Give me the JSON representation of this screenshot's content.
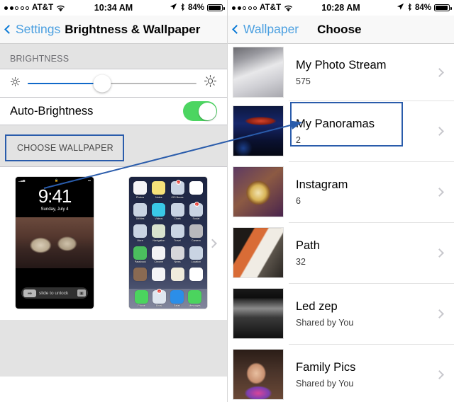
{
  "left_panel": {
    "status_bar": {
      "signal_dots_filled": 2,
      "signal_dots_total": 5,
      "carrier": "AT&T",
      "wifi_icon": "wifi-icon",
      "time": "10:34 AM",
      "location_icon": "location-arrow-icon",
      "bluetooth_icon": "bluetooth-icon",
      "battery_percent": "84%",
      "battery_icon": "battery-icon"
    },
    "nav": {
      "back_icon": "chevron-left-icon",
      "back_label": "Settings",
      "title": "Brightness & Wallpaper"
    },
    "brightness": {
      "section_header": "BRIGHTNESS",
      "slider": {
        "low_icon": "sun-small-icon",
        "high_icon": "sun-large-icon",
        "value_percent": 44,
        "fill_color": "#1169c9",
        "track_color": "#b9b9b9"
      },
      "auto_brightness": {
        "label": "Auto-Brightness",
        "toggle_state": "on",
        "toggle_color": "#4cd561"
      }
    },
    "choose_wallpaper": {
      "header": "CHOOSE WALLPAPER",
      "chevron_icon": "chevron-right-icon",
      "lock_preview": {
        "time": "9:41",
        "date": "Sunday, July 4",
        "slide_text": "slide to unlock",
        "slide_arrow_icon": "arrow-right-icon",
        "camera_icon": "camera-icon",
        "lock_icon": "lock-icon"
      },
      "home_preview": {
        "apps": [
          {
            "label": "Photos",
            "color": "#f4f4f6",
            "badge": ""
          },
          {
            "label": "Notes",
            "color": "#f6e27a",
            "badge": ""
          },
          {
            "label": "iOS Boxes",
            "color": "#c9d4e3",
            "badge": "32"
          },
          {
            "label": "",
            "color": "#ffffff",
            "badge": ""
          },
          {
            "label": "Utilities",
            "color": "#c9d4e3",
            "badge": ""
          },
          {
            "label": "Videos",
            "color": "#39c8e6",
            "badge": ""
          },
          {
            "label": "Chats",
            "color": "#c9d4e3",
            "badge": ""
          },
          {
            "label": "Social",
            "color": "#c9d4e3",
            "badge": "1"
          },
          {
            "label": "More",
            "color": "#c9d4e3",
            "badge": ""
          },
          {
            "label": "Navigation",
            "color": "#d8e2ce",
            "badge": ""
          },
          {
            "label": "Travel",
            "color": "#c9d4e3",
            "badge": ""
          },
          {
            "label": "Camera",
            "color": "#b9b9bd",
            "badge": ""
          },
          {
            "label": "Passbook",
            "color": "#4bbf5e",
            "badge": ""
          },
          {
            "label": "Chrome",
            "color": "#f2f2f4",
            "badge": ""
          },
          {
            "label": "News",
            "color": "#d6d6da",
            "badge": ""
          },
          {
            "label": "Location",
            "color": "#c9d4e3",
            "badge": ""
          },
          {
            "label": "",
            "color": "#8a6a52",
            "badge": ""
          },
          {
            "label": "",
            "color": "#f4f4f6",
            "badge": ""
          },
          {
            "label": "",
            "color": "#f0ebdc",
            "badge": ""
          },
          {
            "label": "",
            "color": "#ffffff",
            "badge": ""
          }
        ],
        "dock": [
          {
            "label": "Phone",
            "color": "#4bd45e",
            "badge": ""
          },
          {
            "label": "Email",
            "color": "#dfe6ef",
            "badge": "8"
          },
          {
            "label": "Safari",
            "color": "#2b8ee8",
            "badge": ""
          },
          {
            "label": "Messages",
            "color": "#4bd45e",
            "badge": ""
          }
        ]
      }
    }
  },
  "right_panel": {
    "status_bar": {
      "signal_dots_filled": 2,
      "signal_dots_total": 5,
      "carrier": "AT&T",
      "wifi_icon": "wifi-icon",
      "time": "10:28 AM",
      "location_icon": "location-arrow-icon",
      "bluetooth_icon": "bluetooth-icon",
      "battery_percent": "84%",
      "battery_icon": "battery-icon"
    },
    "nav": {
      "back_icon": "chevron-left-icon",
      "back_label": "Wallpaper",
      "title": "Choose"
    },
    "albums": [
      {
        "name": "My Photo Stream",
        "detail": "575",
        "art": "art-stream",
        "chevron_icon": "chevron-right-icon"
      },
      {
        "name": "My Panoramas",
        "detail": "2",
        "art": "art-pano",
        "chevron_icon": "chevron-right-icon"
      },
      {
        "name": "Instagram",
        "detail": "6",
        "art": "art-insta",
        "chevron_icon": "chevron-right-icon"
      },
      {
        "name": "Path",
        "detail": "32",
        "art": "art-path2",
        "chevron_icon": "chevron-right-icon"
      },
      {
        "name": "Led zep",
        "detail": "Shared by You",
        "art": "art-led",
        "chevron_icon": "chevron-right-icon"
      },
      {
        "name": "Family Pics",
        "detail": "Shared by You",
        "art": "art-family",
        "chevron_icon": "chevron-right-icon"
      }
    ]
  },
  "annotations": {
    "color": "#2a5cab",
    "box_choose_wallpaper": "highlight around CHOOSE WALLPAPER header",
    "box_my_panoramas": "highlight around My Panoramas row",
    "arrow": "arrow from CHOOSE WALLPAPER to My Panoramas"
  }
}
